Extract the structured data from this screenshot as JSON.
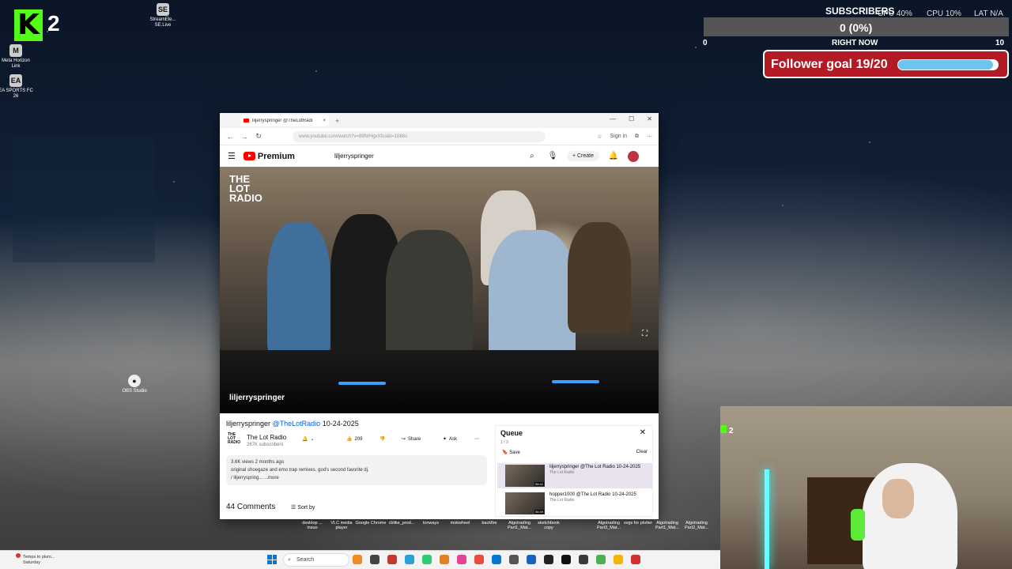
{
  "desktop": {
    "icons": [
      {
        "label": "StreamEle... SE.Live",
        "glyph": "SE"
      },
      {
        "label": "Meta Horizon Link",
        "glyph": "M"
      },
      {
        "label": "EA SPORTS FC 26",
        "glyph": "EA"
      },
      {
        "label": "OBS Studio",
        "glyph": "●"
      }
    ],
    "shortcuts": [
      "desktop ... insuo",
      "VLC media player",
      "Google Chrome",
      "cblike_prod...",
      "tonways",
      "mokwheel",
      "backfire",
      "Algotrading Part1_Mat...",
      "sketchbook copy",
      "Algotrading Part3_Mat...",
      "svgs for plotter",
      "Algotrading Part1_Mat...",
      "Algotrading Part2_Mat..."
    ]
  },
  "kick_overlay": {
    "count": "2",
    "logo": "K"
  },
  "subscriber_overlay": {
    "title": "SUBSCRIBERS",
    "value_text": "0 (0%)",
    "min": "0",
    "max": "10",
    "caption": "RIGHT NOW",
    "progress": 0,
    "cpu_label": "CPU 40%",
    "gpu_label": "CPU 10%",
    "lat_label": "LAT N/A"
  },
  "follower_goal": {
    "label": "Follower goal 19/20",
    "current": 19,
    "target": 20
  },
  "browser": {
    "tab_title": "liljerryspringer @TheLotRadi",
    "close_tab": "×",
    "new_tab": "+",
    "url": "www.youtube.com/watch?v=89NrHgxXfco&t=1086s",
    "sign_in": "Sign in",
    "window_controls": [
      "—",
      "☐",
      "✕"
    ]
  },
  "youtube": {
    "logo_text": "Premium",
    "search_value": "liljerryspringer",
    "create_label": "Create",
    "video": {
      "overlay_brand": "THE LOT RADIO",
      "overlay_label": "liljerryspringer"
    },
    "title": {
      "main": "liljerryspringer ",
      "handle": "@TheLotRadio",
      "date": " 10-24-2025"
    },
    "channel": {
      "logo": "THE LOT RADIO",
      "name": "The Lot Radio",
      "subs": "267K subscribers"
    },
    "actions": {
      "likes": "209",
      "share": "Share",
      "ask": "Ask"
    },
    "description": {
      "meta": "3.6K views  2 months ago",
      "text": "original shoegaze and emo trap remixes. god's second favorite dj.",
      "link": "/ liljerryspring...",
      "more": "...more"
    },
    "comments": {
      "count": "44 Comments",
      "sort": "Sort by"
    },
    "queue": {
      "title": "Queue",
      "count": "1 / 3",
      "save": "Save",
      "clear": "Clear",
      "items": [
        {
          "title": "liljerryspringer @The Lot Radio 10-24-2025",
          "channel": "The Lot Radio",
          "duration": "58:41"
        },
        {
          "title": "hopper1000 @The Lot Radio 10-24-2025",
          "channel": "The Lot Radio",
          "duration": "58:49"
        }
      ]
    }
  },
  "webcam": {
    "badge": "2"
  },
  "taskbar": {
    "weather_line1": "Temps to plum...",
    "weather_line2": "Saturday",
    "search_placeholder": "Search",
    "icon_colors": [
      "#f08a24",
      "#444",
      "#c0392b",
      "#2aa1d6",
      "#2ecc71",
      "#e67e22",
      "#e84393",
      "#e74c3c",
      "#0078d4",
      "#555",
      "#1565c0",
      "#222",
      "#111",
      "#3a3a3a",
      "#4caf50",
      "#f5b400",
      "#d32f2f"
    ]
  }
}
